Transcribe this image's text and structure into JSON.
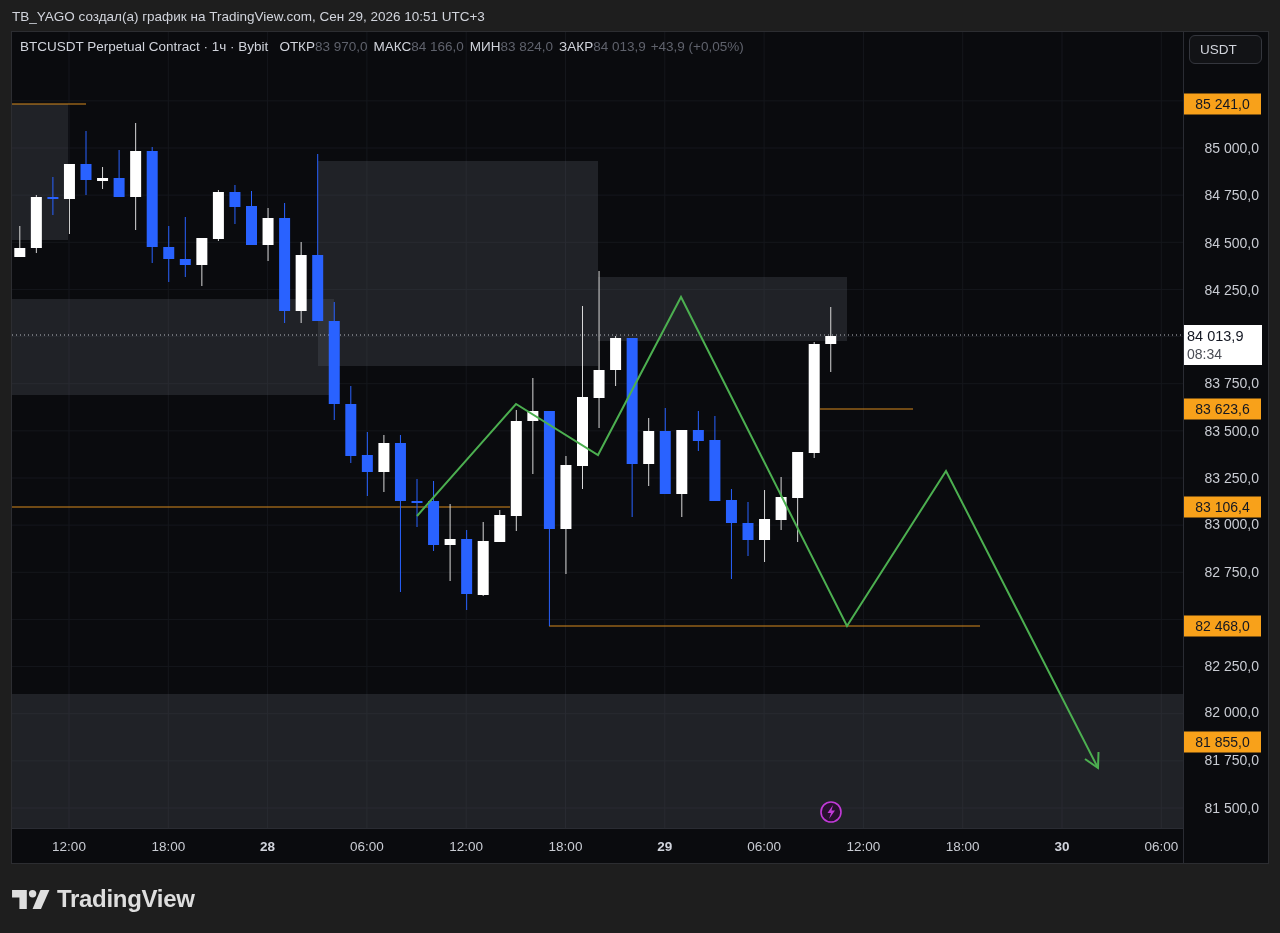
{
  "caption": "TB_YAGO создал(а) график на TradingView.com, Сен 29, 2026 10:51 UTC+3",
  "legend": {
    "symbol": "BTCUSDT Perpetual Contract · 1ч · Bybit",
    "fields": [
      {
        "label": "ОТКР",
        "value": "83 970,0"
      },
      {
        "label": "МАКС",
        "value": "84 166,0"
      },
      {
        "label": "МИН",
        "value": "83 824,0"
      },
      {
        "label": "ЗАКР",
        "value": "84 013,9"
      }
    ],
    "change": "+43,9 (+0,05%)"
  },
  "price_axis": {
    "currency": "USDT",
    "ticks": [
      "85 000,0",
      "84 750,0",
      "84 500,0",
      "84 250,0",
      "83 750,0",
      "83 500,0",
      "83 250,0",
      "83 000,0",
      "82 750,0",
      "82 250,0",
      "82 000,0",
      "81 750,0",
      "81 500,0"
    ],
    "level_tags": [
      "85 241,0",
      "83 623,6",
      "83 106,4",
      "82 468,0",
      "81 855,0"
    ],
    "last_price": {
      "price": "84 013,9",
      "countdown": "08:34"
    }
  },
  "time_axis": {
    "ticks": [
      {
        "label": "12:00",
        "kind": "time"
      },
      {
        "label": "18:00",
        "kind": "time"
      },
      {
        "label": "28",
        "kind": "day"
      },
      {
        "label": "06:00",
        "kind": "time"
      },
      {
        "label": "12:00",
        "kind": "time"
      },
      {
        "label": "18:00",
        "kind": "time"
      },
      {
        "label": "29",
        "kind": "day"
      },
      {
        "label": "06:00",
        "kind": "time"
      },
      {
        "label": "12:00",
        "kind": "time"
      },
      {
        "label": "18:00",
        "kind": "time"
      },
      {
        "label": "30",
        "kind": "day"
      },
      {
        "label": "06:00",
        "kind": "time"
      }
    ]
  },
  "footer": {
    "logo": "TradingView"
  }
}
